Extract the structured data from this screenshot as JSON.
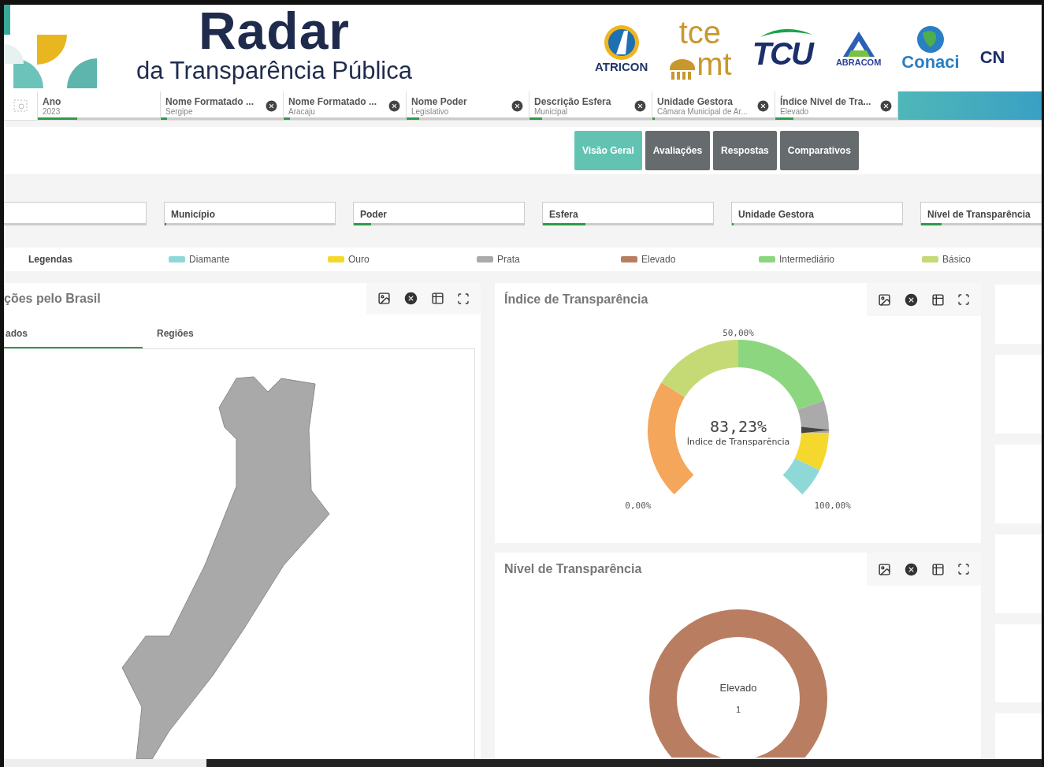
{
  "header": {
    "title": "Radar",
    "subtitle": "da Transparência Pública",
    "partners": [
      {
        "kind": "atricon",
        "lines": [
          "ATRICON"
        ]
      },
      {
        "kind": "tce",
        "lines": [
          "tce",
          "mt"
        ]
      },
      {
        "kind": "tcu",
        "lines": [
          "TCU"
        ]
      },
      {
        "kind": "abracom",
        "lines": [
          "ABRACOM"
        ]
      },
      {
        "kind": "conaci",
        "lines": [
          "Conaci"
        ]
      },
      {
        "kind": "cut",
        "lines": [
          "CN"
        ]
      }
    ]
  },
  "selection_bar": {
    "chips": [
      {
        "field": "Ano",
        "value": "2023",
        "level": 0.32,
        "removable": false
      },
      {
        "field": "Nome Formatado ...",
        "value": "Sergipe",
        "level": 0.05,
        "removable": true
      },
      {
        "field": "Nome Formatado ...",
        "value": "Aracaju",
        "level": 0.05,
        "removable": true
      },
      {
        "field": "Nome Poder",
        "value": "Legislativo",
        "level": 0.1,
        "removable": true
      },
      {
        "field": "Descrição Esfera",
        "value": "Municipal",
        "level": 0.1,
        "removable": true
      },
      {
        "field": "Unidade Gestora",
        "value": "Câmara Municipal de Ar...",
        "level": 0.02,
        "removable": true
      },
      {
        "field": "Índice Nível de Tra...",
        "value": "Elevado",
        "level": 0.15,
        "removable": true
      }
    ]
  },
  "tabs": [
    {
      "label": "Visão Geral",
      "selected": true
    },
    {
      "label": "Avaliações",
      "selected": false
    },
    {
      "label": "Respostas",
      "selected": false
    },
    {
      "label": "Comparativos",
      "selected": false
    }
  ],
  "filters": [
    {
      "kind": "cut"
    },
    {
      "kind": "labeled",
      "label": "Município",
      "level": 0.01
    },
    {
      "kind": "labeled",
      "label": "Poder",
      "level": 0.1
    },
    {
      "kind": "labeled",
      "label": "Esfera",
      "level": 0.25
    },
    {
      "kind": "labeled",
      "label": "Unidade Gestora",
      "level": 0.01
    },
    {
      "kind": "labeled",
      "label": "Nível de Transparência",
      "level": 0.12
    }
  ],
  "legend": {
    "title": "Legendas",
    "items": [
      {
        "label": "Diamante",
        "color": "#8fd8d8"
      },
      {
        "label": "Ouro",
        "color": "#f5d82e"
      },
      {
        "label": "Prata",
        "color": "#aaaaaa"
      },
      {
        "label": "Elevado",
        "color": "#b97e62"
      },
      {
        "label": "Intermediário",
        "color": "#8cd67f"
      },
      {
        "label": "Básico",
        "color": "#c5da74"
      }
    ]
  },
  "map_panel": {
    "title": "ções pelo Brasil",
    "tabs": [
      {
        "label": "ados",
        "selected": true
      },
      {
        "label": "Regiões",
        "selected": false
      }
    ]
  },
  "gauge_panel": {
    "title": "Índice de Transparência",
    "gauge": {
      "value_label": "83,23%",
      "caption": "Índice de Transparência",
      "tick_labels": [
        "0,00%",
        "50,00%",
        "100,00%"
      ],
      "bands": [
        {
          "color": "#f4a65a"
        },
        {
          "color": "#c5da74"
        },
        {
          "color": "#8cd67f"
        },
        {
          "color": "#aaaaaa"
        },
        {
          "color": "#f5d82e"
        },
        {
          "color": "#8fd8d8"
        }
      ]
    }
  },
  "level_panel": {
    "title": "Nível de Transparência",
    "center_label": "Elevado",
    "center_value": "1"
  }
}
